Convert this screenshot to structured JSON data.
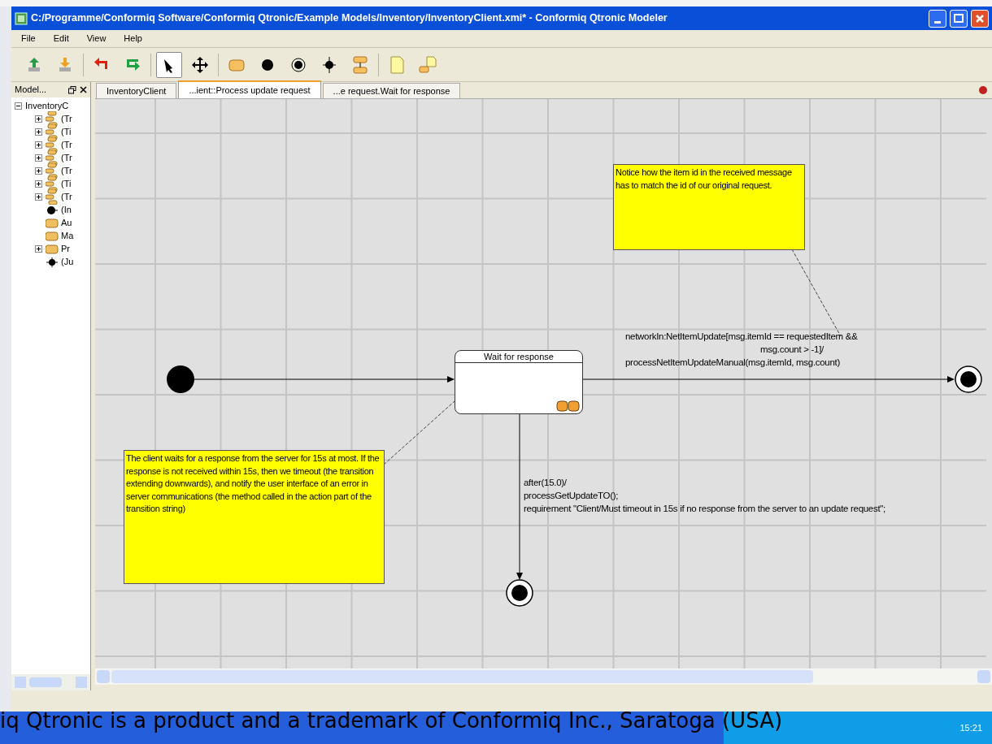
{
  "window": {
    "title": "C:/Programme/Conformiq Software/Conformiq Qtronic/Example Models/Inventory/InventoryClient.xmi* - Conformiq Qtronic Modeler"
  },
  "menu": [
    "File",
    "Edit",
    "View",
    "Help"
  ],
  "toolbar": [
    {
      "kind": "upload",
      "selected": false
    },
    {
      "kind": "download",
      "selected": false
    },
    {
      "kind": "undo",
      "selected": false
    },
    {
      "kind": "redo",
      "selected": false
    },
    {
      "kind": "pointer",
      "selected": true
    },
    {
      "kind": "move",
      "selected": false
    },
    {
      "kind": "state",
      "selected": false
    },
    {
      "kind": "initial",
      "selected": false
    },
    {
      "kind": "final",
      "selected": false
    },
    {
      "kind": "junction",
      "selected": false
    },
    {
      "kind": "compound",
      "selected": false
    },
    {
      "kind": "note",
      "selected": false
    },
    {
      "kind": "note-link",
      "selected": false
    }
  ],
  "model_panel": {
    "title": "Model...",
    "tree": [
      {
        "label": "InventoryC",
        "expanded": true,
        "children": [
          {
            "label": "(Tr",
            "kind": "transition",
            "expanded": false
          },
          {
            "label": "(Ti",
            "kind": "transition",
            "expanded": false
          },
          {
            "label": "(Tr",
            "kind": "transition",
            "expanded": false
          },
          {
            "label": "(Tr",
            "kind": "transition",
            "expanded": false
          },
          {
            "label": "(Tr",
            "kind": "transition",
            "expanded": false
          },
          {
            "label": "(Ti",
            "kind": "transition",
            "expanded": false
          },
          {
            "label": "(Tr",
            "kind": "transition",
            "expanded": false
          },
          {
            "label": "(In",
            "kind": "initial"
          },
          {
            "label": "Au",
            "kind": "state"
          },
          {
            "label": "Ma",
            "kind": "state"
          },
          {
            "label": "Pr",
            "kind": "state",
            "expanded": false
          },
          {
            "label": "(Ju",
            "kind": "junction"
          }
        ]
      }
    ]
  },
  "tabs": [
    {
      "label": "InventoryClient",
      "selected": false
    },
    {
      "label": "...ient::Process update request",
      "selected": true
    },
    {
      "label": "...e request.Wait for response",
      "selected": false
    }
  ],
  "diagram": {
    "states": [
      {
        "title": "Wait for response"
      }
    ],
    "notes": [
      {
        "text": "Notice how the item id in the received message has to match the id of our original request."
      },
      {
        "text": "The client waits for a response from the server for 15s at most. If the response is not received within 15s, then we timeout (the transition extending downwards), and notify the user interface of an error in server communications (the method called in the action part of the transition string)"
      }
    ],
    "transitions": [
      {
        "lines": [
          "networkIn:NetItemUpdate[msg.itemId == requestedItem &&",
          "msg.count > -1]/",
          "processNetItemUpdateManual(msg.itemId, msg.count)"
        ]
      },
      {
        "lines": [
          "after(15.0)/",
          "processGetUpdateTO();",
          "requirement \"Client/Must timeout in 15s if no response from the server to an update request\";"
        ]
      }
    ]
  },
  "caption": "iq Qtronic is a product and a trademark of Conformiq Inc., Saratoga (USA)",
  "taskbar": {
    "clock": "15:21"
  }
}
